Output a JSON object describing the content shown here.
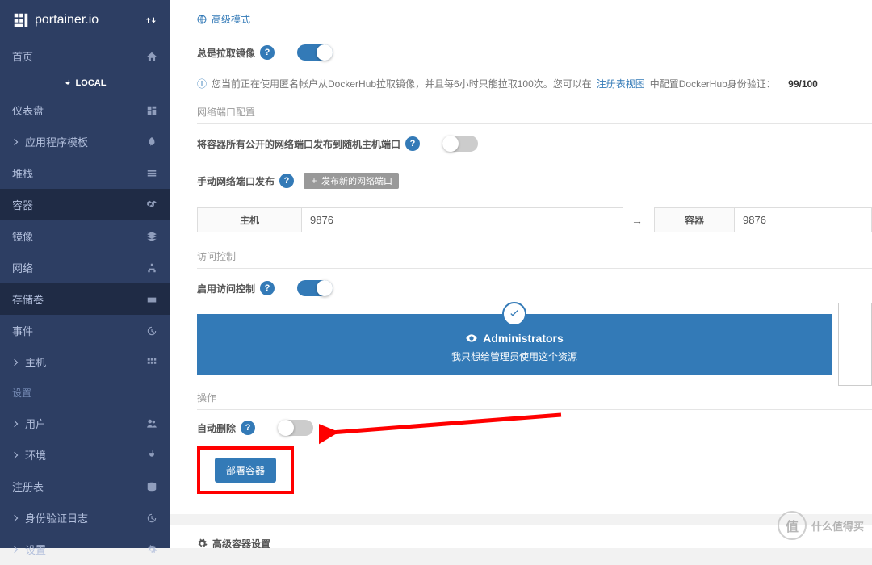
{
  "brand": "portainer.io",
  "local_label": "LOCAL",
  "sidebar": {
    "home": "首页",
    "items": [
      {
        "label": "仪表盘",
        "icon": "dashboard"
      },
      {
        "label": "应用程序模板",
        "icon": "rocket",
        "chevron": true
      },
      {
        "label": "堆栈",
        "icon": "list"
      },
      {
        "label": "容器",
        "icon": "cubes",
        "active": true
      },
      {
        "label": "镜像",
        "icon": "layers"
      },
      {
        "label": "网络",
        "icon": "sitemap"
      },
      {
        "label": "存储卷",
        "icon": "hdd",
        "active": true
      },
      {
        "label": "事件",
        "icon": "history"
      },
      {
        "label": "主机",
        "icon": "grid",
        "chevron": true
      }
    ],
    "settings_header": "设置",
    "settings": [
      {
        "label": "用户",
        "icon": "users",
        "chevron": true
      },
      {
        "label": "环境",
        "icon": "plug",
        "chevron": true
      },
      {
        "label": "注册表",
        "icon": "database"
      },
      {
        "label": "身份验证日志",
        "icon": "history",
        "chevron": true
      },
      {
        "label": "设置",
        "icon": "cogs",
        "chevron": true
      }
    ]
  },
  "main": {
    "advanced_mode": "高级模式",
    "always_pull": "总是拉取镜像",
    "info_pre": "您当前正在使用匿名帐户从DockerHub拉取镜像，并且每6小时只能拉取100次。您可以在",
    "info_link": "注册表视图",
    "info_post": "中配置DockerHub身份验证：",
    "info_counter": "99/100",
    "port_section": "网络端口配置",
    "publish_all": "将容器所有公开的网络端口发布到随机主机端口",
    "manual_publish": "手动网络端口发布",
    "add_port_btn": "发布新的网络端口",
    "host_label": "主机",
    "container_label": "容器",
    "host_port": "9876",
    "container_port": "9876",
    "access_section": "访问控制",
    "enable_access": "启用访问控制",
    "admin_title": "Administrators",
    "admin_sub": "我只想给管理员使用这个资源",
    "action_section": "操作",
    "auto_remove": "自动删除",
    "deploy_btn": "部署容器",
    "adv_settings": "高级容器设置"
  },
  "watermark": "什么值得买"
}
